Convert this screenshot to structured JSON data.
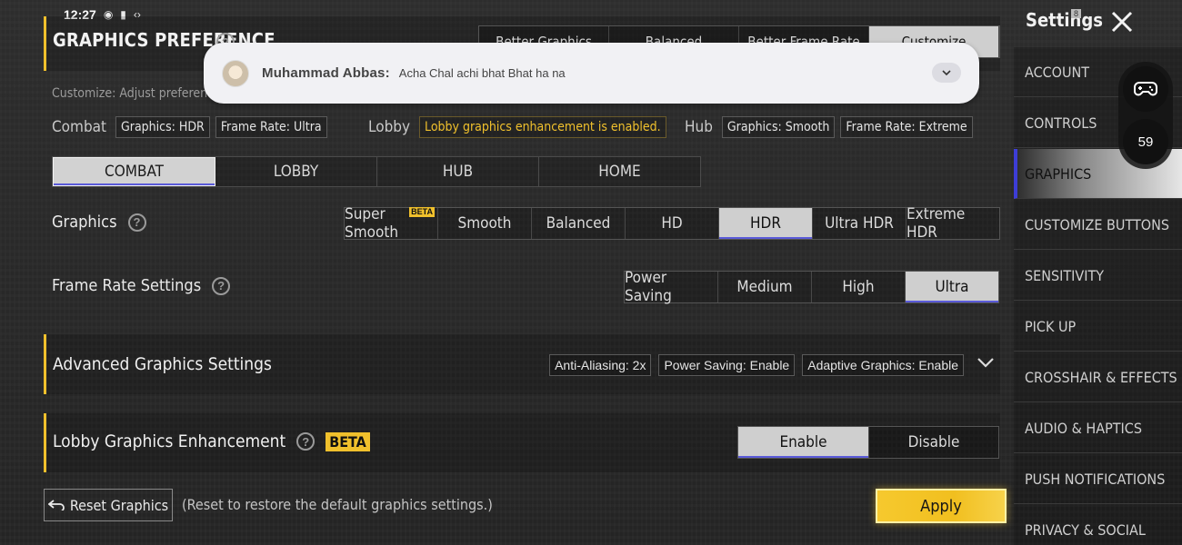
{
  "status_bar": {
    "time": "12:27",
    "icons": [
      "whatsapp-icon",
      "battery-saver-icon",
      "network-icon"
    ]
  },
  "header": {
    "title": "GRAPHICS PREFERENCE",
    "preference_tabs": [
      "Better Graphics",
      "Balanced",
      "Better Frame Rate",
      "Customize"
    ],
    "active_preference_tab": "Customize",
    "customize_note": "Customize: Adjust preferences"
  },
  "summary": {
    "combat": {
      "label": "Combat",
      "graphics": "Graphics: HDR",
      "frame_rate": "Frame Rate: Ultra"
    },
    "lobby": {
      "label": "Lobby",
      "status": "Lobby graphics enhancement is enabled."
    },
    "hub": {
      "label": "Hub",
      "graphics": "Graphics: Smooth",
      "frame_rate": "Frame Rate: Extreme"
    }
  },
  "mode_tabs": [
    "COMBAT",
    "LOBBY",
    "HUB",
    "HOME"
  ],
  "active_mode_tab": "COMBAT",
  "graphics": {
    "label": "Graphics",
    "options": [
      "Super Smooth",
      "Smooth",
      "Balanced",
      "HD",
      "HDR",
      "Ultra HDR",
      "Extreme HDR"
    ],
    "beta_badge": "BETA",
    "selected": "HDR"
  },
  "frame_rate": {
    "label": "Frame Rate Settings",
    "options": [
      "Power Saving",
      "Medium",
      "High",
      "Ultra"
    ],
    "selected": "Ultra"
  },
  "advanced": {
    "title": "Advanced Graphics Settings",
    "chips": [
      "Anti-Aliasing: 2x",
      "Power Saving: Enable",
      "Adaptive Graphics: Enable"
    ]
  },
  "lobby_enhancement": {
    "title": "Lobby Graphics Enhancement",
    "beta_label": "BETA",
    "options": [
      "Enable",
      "Disable"
    ],
    "selected": "Enable"
  },
  "footer": {
    "reset_label": "Reset Graphics",
    "reset_note": "(Reset to restore the default graphics settings.)",
    "apply_label": "Apply"
  },
  "sidebar": {
    "title": "Settings",
    "badge": "8",
    "items": [
      "ACCOUNT",
      "CONTROLS",
      "GRAPHICS",
      "CUSTOMIZE BUTTONS",
      "SENSITIVITY",
      "PICK UP",
      "CROSSHAIR & EFFECTS",
      "AUDIO & HAPTICS",
      "PUSH NOTIFICATIONS",
      "PRIVACY & SOCIAL"
    ],
    "active": "GRAPHICS"
  },
  "floating_widget": {
    "fps": "59"
  },
  "notification": {
    "sender": "Muhammad Abbas:",
    "message": "Acha Chal achi bhat Bhat ha na"
  },
  "colors": {
    "accent_yellow": "#f0c02c",
    "selection_blue": "#3d3dd6",
    "background": "#2a2a2a"
  }
}
